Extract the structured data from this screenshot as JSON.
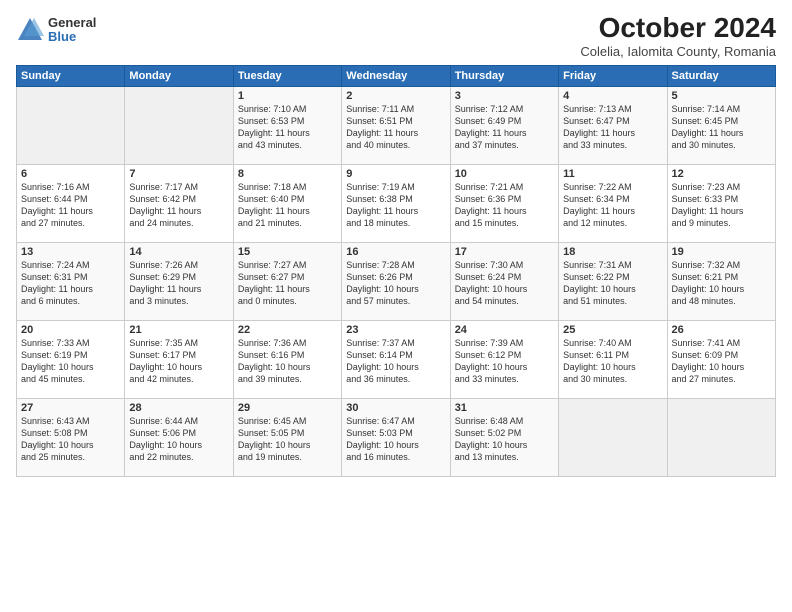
{
  "logo": {
    "general": "General",
    "blue": "Blue"
  },
  "header": {
    "month": "October 2024",
    "location": "Colelia, Ialomita County, Romania"
  },
  "weekdays": [
    "Sunday",
    "Monday",
    "Tuesday",
    "Wednesday",
    "Thursday",
    "Friday",
    "Saturday"
  ],
  "weeks": [
    [
      {
        "num": "",
        "info": ""
      },
      {
        "num": "",
        "info": ""
      },
      {
        "num": "1",
        "info": "Sunrise: 7:10 AM\nSunset: 6:53 PM\nDaylight: 11 hours\nand 43 minutes."
      },
      {
        "num": "2",
        "info": "Sunrise: 7:11 AM\nSunset: 6:51 PM\nDaylight: 11 hours\nand 40 minutes."
      },
      {
        "num": "3",
        "info": "Sunrise: 7:12 AM\nSunset: 6:49 PM\nDaylight: 11 hours\nand 37 minutes."
      },
      {
        "num": "4",
        "info": "Sunrise: 7:13 AM\nSunset: 6:47 PM\nDaylight: 11 hours\nand 33 minutes."
      },
      {
        "num": "5",
        "info": "Sunrise: 7:14 AM\nSunset: 6:45 PM\nDaylight: 11 hours\nand 30 minutes."
      }
    ],
    [
      {
        "num": "6",
        "info": "Sunrise: 7:16 AM\nSunset: 6:44 PM\nDaylight: 11 hours\nand 27 minutes."
      },
      {
        "num": "7",
        "info": "Sunrise: 7:17 AM\nSunset: 6:42 PM\nDaylight: 11 hours\nand 24 minutes."
      },
      {
        "num": "8",
        "info": "Sunrise: 7:18 AM\nSunset: 6:40 PM\nDaylight: 11 hours\nand 21 minutes."
      },
      {
        "num": "9",
        "info": "Sunrise: 7:19 AM\nSunset: 6:38 PM\nDaylight: 11 hours\nand 18 minutes."
      },
      {
        "num": "10",
        "info": "Sunrise: 7:21 AM\nSunset: 6:36 PM\nDaylight: 11 hours\nand 15 minutes."
      },
      {
        "num": "11",
        "info": "Sunrise: 7:22 AM\nSunset: 6:34 PM\nDaylight: 11 hours\nand 12 minutes."
      },
      {
        "num": "12",
        "info": "Sunrise: 7:23 AM\nSunset: 6:33 PM\nDaylight: 11 hours\nand 9 minutes."
      }
    ],
    [
      {
        "num": "13",
        "info": "Sunrise: 7:24 AM\nSunset: 6:31 PM\nDaylight: 11 hours\nand 6 minutes."
      },
      {
        "num": "14",
        "info": "Sunrise: 7:26 AM\nSunset: 6:29 PM\nDaylight: 11 hours\nand 3 minutes."
      },
      {
        "num": "15",
        "info": "Sunrise: 7:27 AM\nSunset: 6:27 PM\nDaylight: 11 hours\nand 0 minutes."
      },
      {
        "num": "16",
        "info": "Sunrise: 7:28 AM\nSunset: 6:26 PM\nDaylight: 10 hours\nand 57 minutes."
      },
      {
        "num": "17",
        "info": "Sunrise: 7:30 AM\nSunset: 6:24 PM\nDaylight: 10 hours\nand 54 minutes."
      },
      {
        "num": "18",
        "info": "Sunrise: 7:31 AM\nSunset: 6:22 PM\nDaylight: 10 hours\nand 51 minutes."
      },
      {
        "num": "19",
        "info": "Sunrise: 7:32 AM\nSunset: 6:21 PM\nDaylight: 10 hours\nand 48 minutes."
      }
    ],
    [
      {
        "num": "20",
        "info": "Sunrise: 7:33 AM\nSunset: 6:19 PM\nDaylight: 10 hours\nand 45 minutes."
      },
      {
        "num": "21",
        "info": "Sunrise: 7:35 AM\nSunset: 6:17 PM\nDaylight: 10 hours\nand 42 minutes."
      },
      {
        "num": "22",
        "info": "Sunrise: 7:36 AM\nSunset: 6:16 PM\nDaylight: 10 hours\nand 39 minutes."
      },
      {
        "num": "23",
        "info": "Sunrise: 7:37 AM\nSunset: 6:14 PM\nDaylight: 10 hours\nand 36 minutes."
      },
      {
        "num": "24",
        "info": "Sunrise: 7:39 AM\nSunset: 6:12 PM\nDaylight: 10 hours\nand 33 minutes."
      },
      {
        "num": "25",
        "info": "Sunrise: 7:40 AM\nSunset: 6:11 PM\nDaylight: 10 hours\nand 30 minutes."
      },
      {
        "num": "26",
        "info": "Sunrise: 7:41 AM\nSunset: 6:09 PM\nDaylight: 10 hours\nand 27 minutes."
      }
    ],
    [
      {
        "num": "27",
        "info": "Sunrise: 6:43 AM\nSunset: 5:08 PM\nDaylight: 10 hours\nand 25 minutes."
      },
      {
        "num": "28",
        "info": "Sunrise: 6:44 AM\nSunset: 5:06 PM\nDaylight: 10 hours\nand 22 minutes."
      },
      {
        "num": "29",
        "info": "Sunrise: 6:45 AM\nSunset: 5:05 PM\nDaylight: 10 hours\nand 19 minutes."
      },
      {
        "num": "30",
        "info": "Sunrise: 6:47 AM\nSunset: 5:03 PM\nDaylight: 10 hours\nand 16 minutes."
      },
      {
        "num": "31",
        "info": "Sunrise: 6:48 AM\nSunset: 5:02 PM\nDaylight: 10 hours\nand 13 minutes."
      },
      {
        "num": "",
        "info": ""
      },
      {
        "num": "",
        "info": ""
      }
    ]
  ]
}
